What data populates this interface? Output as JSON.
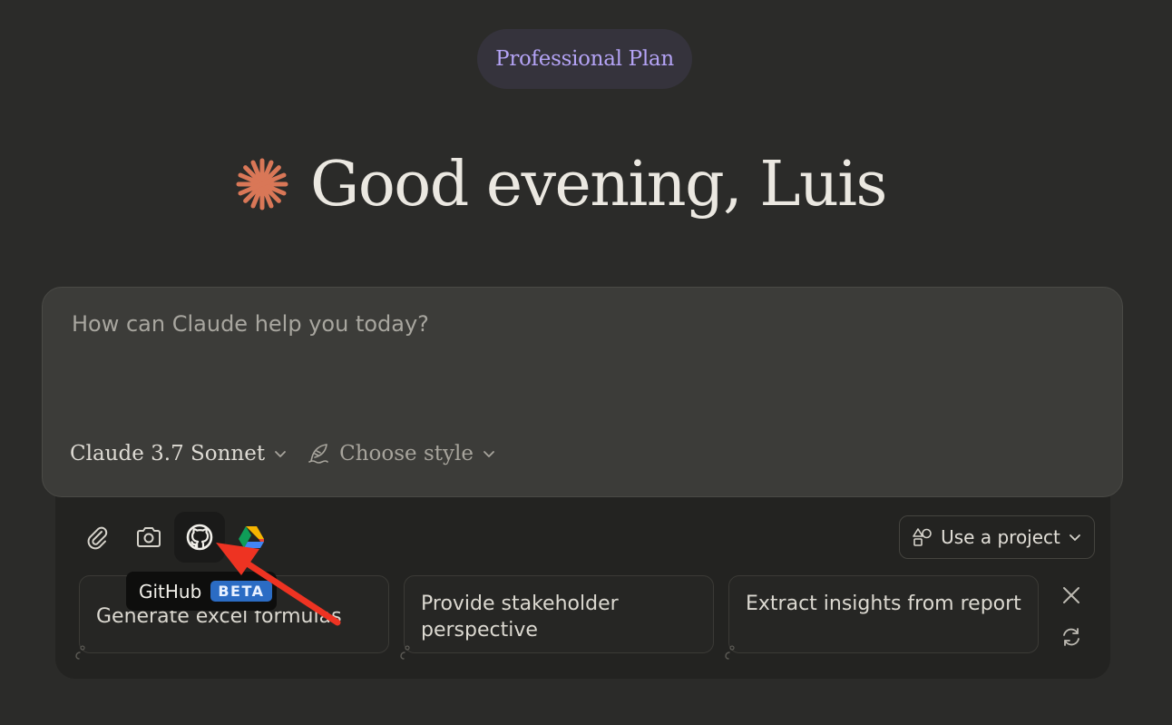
{
  "plan": {
    "label": "Professional Plan"
  },
  "greeting": {
    "text": "Good evening, Luis"
  },
  "composer": {
    "placeholder": "How can Claude help you today?",
    "model_label": "Claude 3.7 Sonnet",
    "style_label": "Choose style"
  },
  "tools": [
    {
      "icon": "paperclip-icon"
    },
    {
      "icon": "camera-icon"
    },
    {
      "icon": "github-icon"
    },
    {
      "icon": "google-drive-icon"
    }
  ],
  "project": {
    "label": "Use a project"
  },
  "tooltip": {
    "label": "GitHub",
    "badge": "BETA"
  },
  "suggestions": [
    {
      "text": "Generate excel formulas"
    },
    {
      "text": "Provide stakeholder perspective"
    },
    {
      "text": "Extract insights from report"
    }
  ],
  "colors": {
    "background": "#2b2b29",
    "composer": "#3c3c39",
    "plan_text": "#b4a3f5",
    "spark": "#d97757",
    "beta": "#2b6cc4",
    "annotation_arrow": "#ee3322"
  }
}
